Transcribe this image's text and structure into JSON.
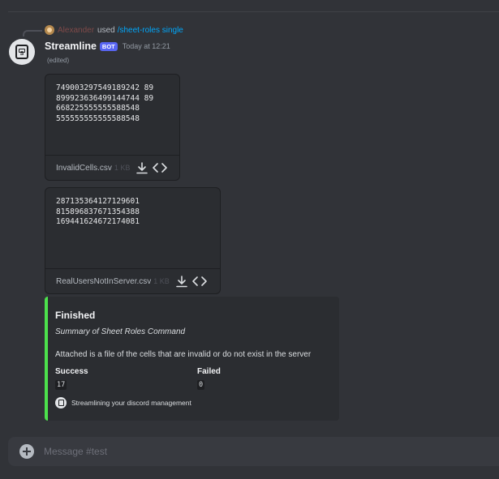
{
  "reply": {
    "username": "Alexander",
    "used_text": "used",
    "command": "/sheet-roles single"
  },
  "message": {
    "author": "Streamline",
    "bot_tag": "BOT",
    "timestamp": "Today at 12:21",
    "edited": "(edited)"
  },
  "attachments": [
    {
      "content": "749003297549189242 89\n899923636499144744 89\n668225555555588548\n555555555555588548",
      "filename": "InvalidCells.csv",
      "size": "1 KB"
    },
    {
      "content": "287135364127129601\n815896837671354388\n169441624672174081",
      "filename": "RealUsersNotInServer.csv",
      "size": "1 KB"
    }
  ],
  "embed": {
    "accent_color": "#4ce14c",
    "title": "Finished",
    "description": "Summary of Sheet Roles Command",
    "text": "Attached is a file of the cells that are invalid or do not exist in the server",
    "fields": [
      {
        "name": "Success",
        "value": "17"
      },
      {
        "name": "Failed",
        "value": "0"
      }
    ],
    "footer": "Streamlining your discord management"
  },
  "composer": {
    "placeholder": "Message #test"
  },
  "icons": {
    "download": "download-icon",
    "code": "code-view-icon",
    "add": "plus-circle-icon"
  }
}
